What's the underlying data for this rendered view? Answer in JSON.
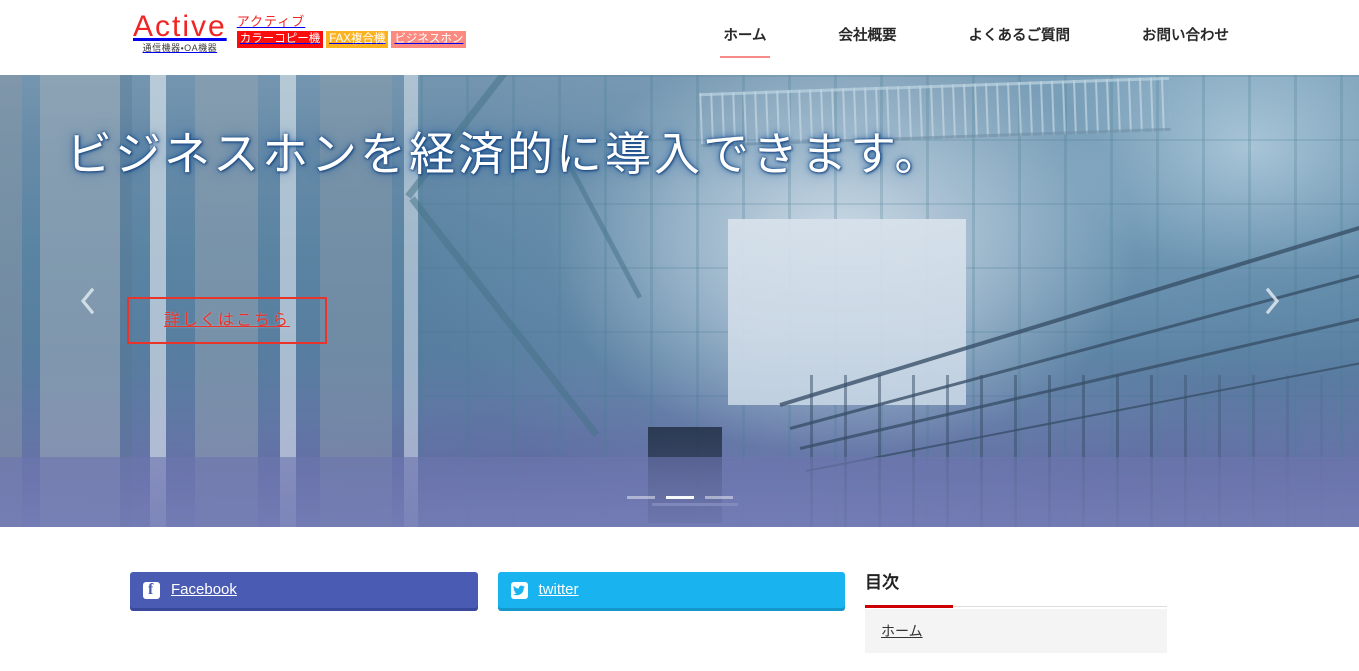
{
  "header": {
    "brand": {
      "word": "Active",
      "sub": "通信機器・OA機器",
      "kana": "アクティブ",
      "badges": [
        {
          "label": "カラーコピー機",
          "color": "#fb0d0d"
        },
        {
          "label": "FAX複合機",
          "color": "#fcb322"
        },
        {
          "label": "ビジネスホン",
          "color": "#fb8a80"
        }
      ]
    },
    "nav": [
      {
        "label": "ホーム",
        "active": true
      },
      {
        "label": "会社概要",
        "active": false
      },
      {
        "label": "よくあるご質問",
        "active": false
      },
      {
        "label": "お問い合わせ",
        "active": false
      }
    ],
    "nav_active_underline_color": "#f98a8a"
  },
  "hero": {
    "title": "ビジネスホンを経済的に導入できます。",
    "cta_label": "詳しくはこちら",
    "cta_color": "#e8342b",
    "prev_icon": "chevron-left-icon",
    "next_icon": "chevron-right-icon",
    "slide_count": 3,
    "active_slide": 2
  },
  "social": {
    "facebook": {
      "label": "Facebook",
      "icon": "facebook-icon",
      "color": "#4a5bb4"
    },
    "twitter": {
      "label": "twitter",
      "icon": "twitter-bird-icon",
      "color": "#19b3ef"
    }
  },
  "sidebar": {
    "title": "目次",
    "accent_color": "#cc0000",
    "items": [
      {
        "label": "ホーム"
      }
    ]
  }
}
